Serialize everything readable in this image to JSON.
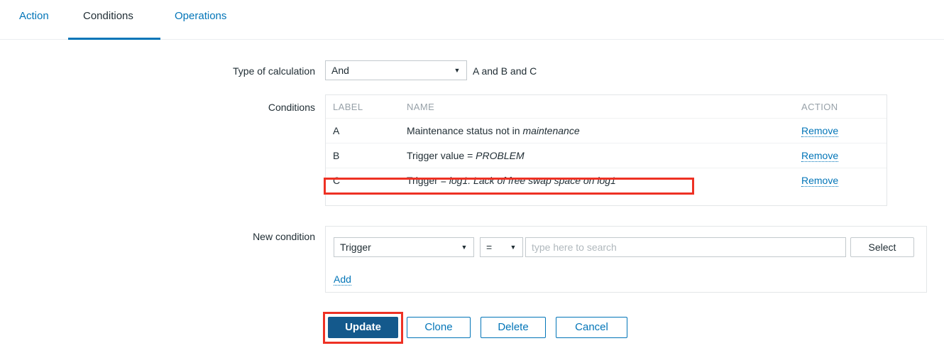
{
  "tabs": [
    {
      "label": "Action",
      "active": false
    },
    {
      "label": "Conditions",
      "active": true
    },
    {
      "label": "Operations",
      "active": false
    }
  ],
  "form": {
    "type_of_calculation": {
      "label": "Type of calculation",
      "value": "And",
      "formula": "A and B and C",
      "caret": "▼"
    },
    "conditions": {
      "label": "Conditions",
      "columns": [
        "LABEL",
        "NAME",
        "ACTION"
      ],
      "rows": [
        {
          "label": "A",
          "name_prefix": "Maintenance status not in ",
          "name_value": "maintenance",
          "action": "Remove"
        },
        {
          "label": "B",
          "name_prefix": "Trigger value = ",
          "name_value": "PROBLEM",
          "action": "Remove"
        },
        {
          "label": "C",
          "name_prefix": "Trigger = ",
          "name_value": "log1: Lack of free swap space on log1",
          "action": "Remove"
        }
      ]
    },
    "new_condition": {
      "label": "New condition",
      "type_value": "Trigger",
      "operator_value": "=",
      "caret": "▼",
      "search_value": "",
      "search_placeholder": "type here to search",
      "select_button": "Select",
      "add_link": "Add"
    }
  },
  "footer": {
    "update": "Update",
    "clone": "Clone",
    "delete": "Delete",
    "cancel": "Cancel"
  },
  "colors": {
    "accent": "#0275b8",
    "primary_button": "#14598c",
    "highlight": "#ee3124",
    "header_text": "#97a1a8"
  }
}
